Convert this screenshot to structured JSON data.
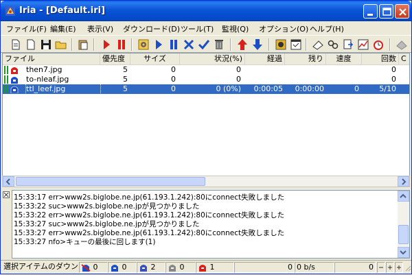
{
  "window": {
    "title": "Iria - [Default.iri]",
    "accent": "#316ac5"
  },
  "menu": [
    "ファイル(F)",
    "編集(E)",
    "表示(V)",
    "ダウンロード(D)",
    "ツール(T)",
    "監視(Q)",
    "オプション(O)",
    "ヘルプ(H)"
  ],
  "toolbar": {
    "icons": [
      "new-icon",
      "open-icon",
      "save-icon",
      "folder-icon",
      "paste-icon",
      "start-icon",
      "pause-icon",
      "settings-icon",
      "play-icon",
      "pause-all-icon",
      "delete-icon",
      "check-icon",
      "trash-icon",
      "move-up-icon",
      "move-down-icon",
      "schedule-icon",
      "window-icon",
      "erase-icon",
      "link-icon",
      "import-icon",
      "graph-icon",
      "alarm-icon"
    ]
  },
  "list": {
    "columns": [
      "ファイル",
      "優先度",
      "サイズ",
      "状況(%)",
      "経過",
      "残り",
      "速度",
      "回数",
      "C"
    ],
    "rows": [
      {
        "file": "then7.jpg",
        "priority": "5",
        "size": "0",
        "status": "0",
        "elapsed": "",
        "remaining": "",
        "speed": "",
        "count": "0",
        "selected": false
      },
      {
        "file": "to-nleaf.jpg",
        "priority": "5",
        "size": "0",
        "status": "0",
        "elapsed": "",
        "remaining": "",
        "speed": "",
        "count": "0",
        "selected": false
      },
      {
        "file": "ttl_leef.jpg",
        "priority": "5",
        "size": "0",
        "status": "0 (0%)",
        "elapsed": "0:00:05",
        "remaining": "0:00:00",
        "speed": "0",
        "count": "5/10",
        "selected": true
      }
    ]
  },
  "log": [
    "15:33:17 err>www2s.biglobe.ne.jp(61.193.1.242):80にconnect失敗しました",
    "15:33:22 suc>www2s.biglobe.ne.jpが見つかりました",
    "15:33:22 err>www2s.biglobe.ne.jp(61.193.1.242):80にconnect失敗しました",
    "15:33:27 suc>www2s.biglobe.ne.jpが見つかりました",
    "15:33:27 err>www2s.biglobe.ne.jp(61.193.1.242):80にconnect失敗しました",
    "15:33:27 nfo>キューの最後に回します(1)"
  ],
  "status": {
    "label": "選択アイテムのダウン",
    "count1": "0",
    "count2": "0",
    "count3": "2",
    "count4": "0",
    "count5": "1",
    "speed_total": "0",
    "speed": "0 b/s",
    "spinner_value": "0"
  }
}
